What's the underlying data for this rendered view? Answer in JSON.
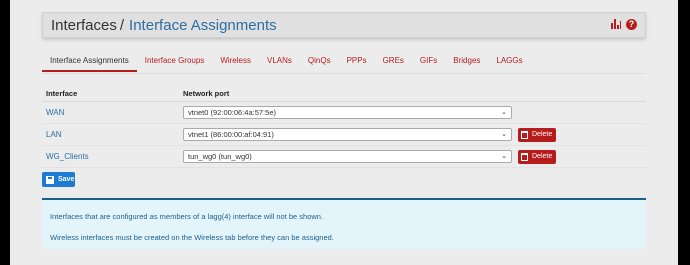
{
  "breadcrumb": {
    "parent": "Interfaces",
    "separator": "/",
    "current": "Interface Assignments"
  },
  "header_icons": [
    "bar-chart-icon",
    "help-icon"
  ],
  "help_glyph": "?",
  "tabs": [
    {
      "label": "Interface Assignments",
      "active": true
    },
    {
      "label": "Interface Groups"
    },
    {
      "label": "Wireless"
    },
    {
      "label": "VLANs"
    },
    {
      "label": "QinQs"
    },
    {
      "label": "PPPs"
    },
    {
      "label": "GREs"
    },
    {
      "label": "GIFs"
    },
    {
      "label": "Bridges"
    },
    {
      "label": "LAGGs"
    }
  ],
  "table": {
    "headers": {
      "interface": "Interface",
      "port": "Network port"
    },
    "rows": [
      {
        "interface": "WAN",
        "port": "vtnet0 (92:00:06:4a:57:5e)",
        "delete": null
      },
      {
        "interface": "LAN",
        "port": "vtnet1 (86:00:00:af:04:91)",
        "delete": "Delete"
      },
      {
        "interface": "WG_Clients",
        "port": "tun_wg0 (tun_wg0)",
        "delete": "Delete"
      }
    ]
  },
  "save_label": "Save",
  "info": {
    "line1": "Interfaces that are configured as members of a lagg(4) interface will not be shown.",
    "line2": "Wireless interfaces must be created on the Wireless tab before they can be assigned."
  },
  "colors": {
    "accent_red": "#b71c1c",
    "link_blue": "#2b6ea3",
    "save_blue": "#1e7bd3",
    "info_bg": "#e3f5fb",
    "info_text": "#1b5f8f"
  }
}
